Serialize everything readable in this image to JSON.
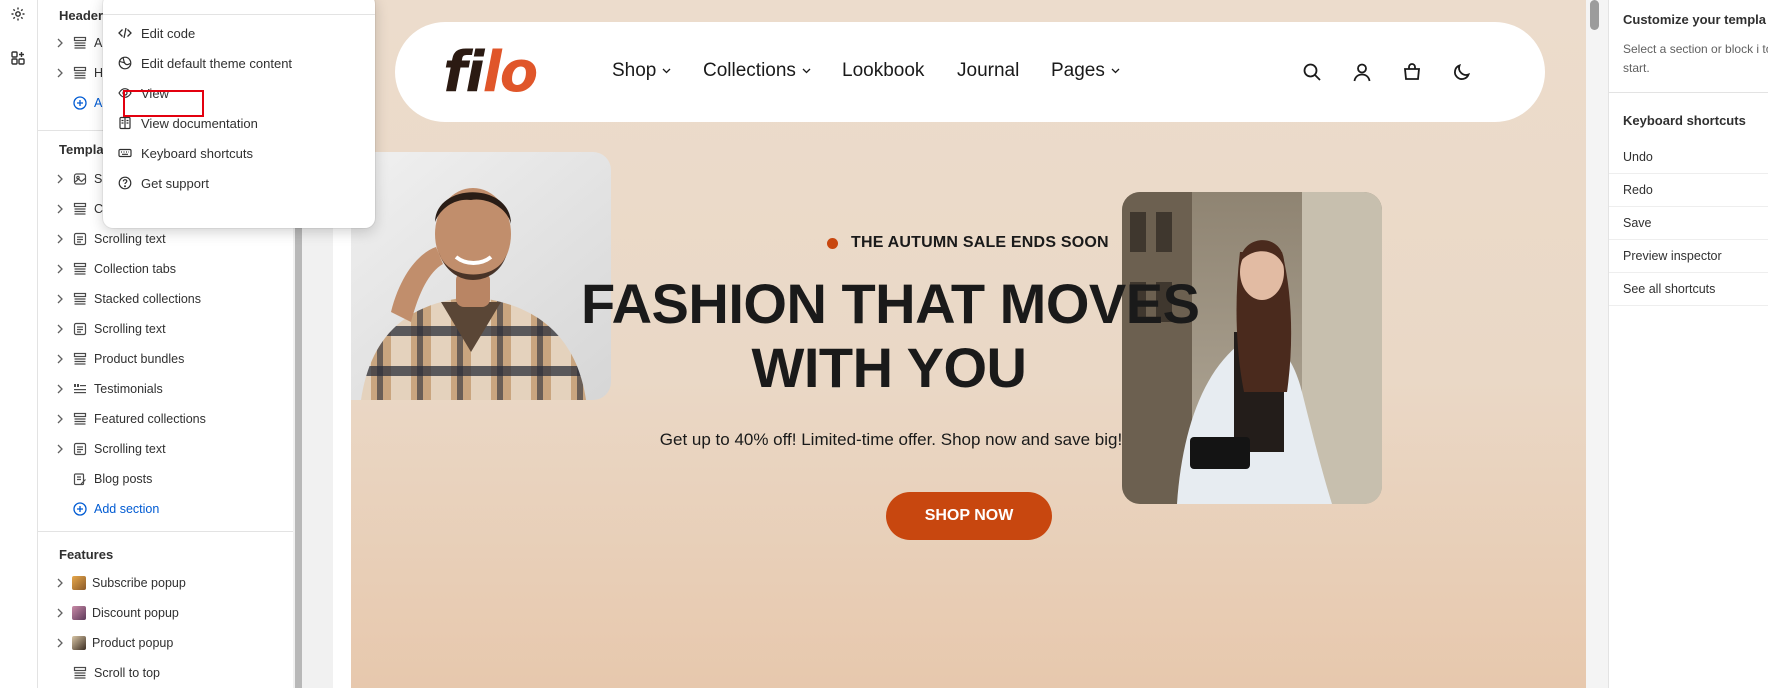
{
  "menu": {
    "items": [
      {
        "label": "Edit code",
        "icon": "code-icon"
      },
      {
        "label": "Edit default theme content",
        "icon": "globe-icon"
      },
      {
        "label": "View",
        "icon": "eye-icon"
      },
      {
        "label": "View documentation",
        "icon": "book-icon"
      },
      {
        "label": "Keyboard shortcuts",
        "icon": "keyboard-icon"
      },
      {
        "label": "Get support",
        "icon": "question-icon"
      }
    ]
  },
  "sidebar": {
    "header_group": {
      "title": "Header",
      "items": [
        {
          "label": "An",
          "icon": "section-icon"
        },
        {
          "label": "He",
          "icon": "section-icon"
        }
      ],
      "add_label": "Add"
    },
    "template_group": {
      "title": "Template",
      "items": [
        {
          "label": "Slid",
          "icon": "slideshow-icon"
        },
        {
          "label": "Co",
          "icon": "section-icon"
        },
        {
          "label": "Scrolling text",
          "icon": "text-icon"
        },
        {
          "label": "Collection tabs",
          "icon": "section-icon"
        },
        {
          "label": "Stacked collections",
          "icon": "section-icon"
        },
        {
          "label": "Scrolling text",
          "icon": "text-icon"
        },
        {
          "label": "Product bundles",
          "icon": "section-icon"
        },
        {
          "label": "Testimonials",
          "icon": "quote-icon"
        },
        {
          "label": "Featured collections",
          "icon": "section-icon"
        },
        {
          "label": "Scrolling text",
          "icon": "text-icon"
        },
        {
          "label": "Blog posts",
          "icon": "blog-icon"
        }
      ],
      "add_label": "Add section"
    },
    "features_group": {
      "title": "Features",
      "items": [
        {
          "label": "Subscribe popup",
          "icon": "popup-thumb-icon"
        },
        {
          "label": "Discount popup",
          "icon": "popup-thumb-icon"
        },
        {
          "label": "Product popup",
          "icon": "popup-thumb-icon"
        },
        {
          "label": "Scroll to top",
          "icon": "section-icon"
        }
      ]
    }
  },
  "preview": {
    "logo_part1": "fi",
    "logo_part2": "lo",
    "nav": [
      "Shop",
      "Collections",
      "Lookbook",
      "Journal",
      "Pages"
    ],
    "eyebrow": "THE AUTUMN SALE ENDS SOON",
    "headline_line1": "FASHION THAT MOVES",
    "headline_line2": "WITH YOU",
    "subtext": "Get up to 40% off! Limited-time offer. Shop now and save big!",
    "cta": "SHOP NOW",
    "colors": {
      "accent": "#c8470f",
      "logo_accent": "#e0562a",
      "background": "#ecdccc"
    }
  },
  "right_panel": {
    "title": "Customize your templa",
    "description": "Select a section or block i to start.",
    "shortcuts_title": "Keyboard shortcuts",
    "shortcuts": [
      "Undo",
      "Redo",
      "Save",
      "Preview inspector",
      "See all shortcuts"
    ]
  }
}
